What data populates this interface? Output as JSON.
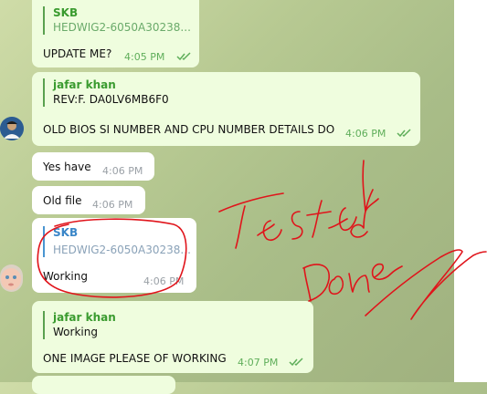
{
  "colors": {
    "annotation": "#e0141b",
    "out_bubble": "#effdde",
    "in_bubble": "#ffffff",
    "accent_green": "#3a9b2f",
    "accent_blue": "#3a86c8"
  },
  "messages": [
    {
      "direction": "out",
      "reply_name": "SKB",
      "reply_text": "HEDWIG2-6050A30238...",
      "text": "UPDATE ME?",
      "time": "4:05 PM",
      "status": "read"
    },
    {
      "direction": "out",
      "reply_name": "jafar khan",
      "reply_text": "REV:F.  DA0LV6MB6F0",
      "text": "OLD BIOS SI NUMBER AND CPU NUMBER DETAILS DO",
      "time": "4:06 PM",
      "status": "read"
    },
    {
      "direction": "in",
      "text": "Yes have",
      "time": "4:06 PM"
    },
    {
      "direction": "in",
      "text": "Old file",
      "time": "4:06 PM"
    },
    {
      "direction": "in",
      "reply_name": "SKB",
      "reply_text": "HEDWIG2-6050A30238...",
      "text": "Working",
      "time": "4:06 PM"
    },
    {
      "direction": "out",
      "reply_name": "jafar khan",
      "reply_text": "Working",
      "text": "ONE IMAGE PLEASE OF WORKING",
      "time": "4:07 PM",
      "status": "read"
    }
  ],
  "handwriting": {
    "line1": "Tested",
    "line2": "Done"
  },
  "icons": {
    "read_status": "double-check-icon"
  }
}
